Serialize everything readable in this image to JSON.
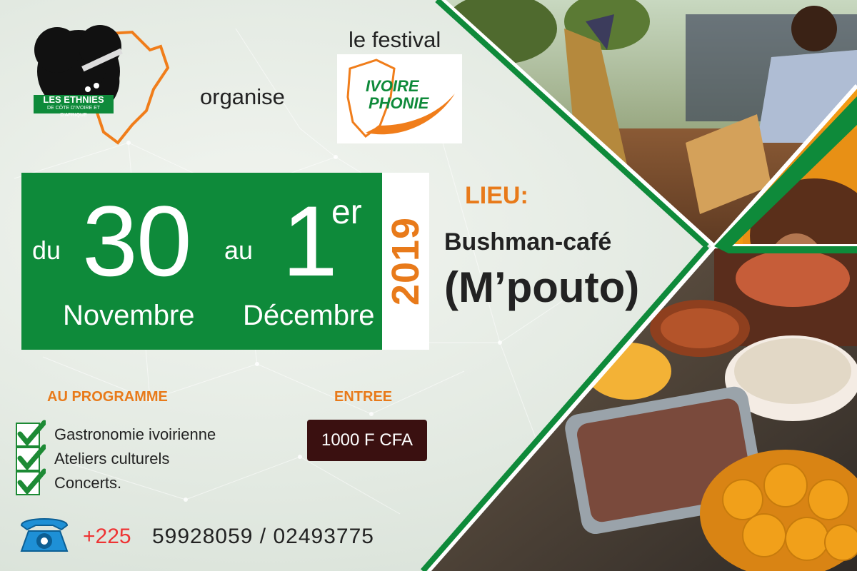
{
  "organizer": {
    "logo_text": "LES ETHNIES",
    "logo_subtext": "DE CÔTE D'IVOIRE ET D'AFRIQUE",
    "organise_label": "organise"
  },
  "festival": {
    "prefix": "le festival",
    "logo_line1": "IVOIRE",
    "logo_line2": "PHONIE"
  },
  "dates": {
    "from_word": "du",
    "from_day": "30",
    "from_month": "Novembre",
    "to_word": "au",
    "to_day": "1",
    "to_suffix": "er",
    "to_month": "Décembre",
    "year": "2019"
  },
  "venue": {
    "label": "LIEU:",
    "name": "Bushman-café",
    "area": "(M’pouto)"
  },
  "programme": {
    "title": "AU PROGRAMME",
    "items": [
      "Gastronomie ivoirienne",
      "Ateliers culturels",
      "Concerts."
    ]
  },
  "entry": {
    "title": "ENTREE",
    "price": "1000 F CFA"
  },
  "contact": {
    "prefix": "+225",
    "numbers": "59928059 / 02493775"
  },
  "colors": {
    "green": "#0e8a3a",
    "orange": "#e87a1a",
    "dark_brown": "#3a1010"
  }
}
